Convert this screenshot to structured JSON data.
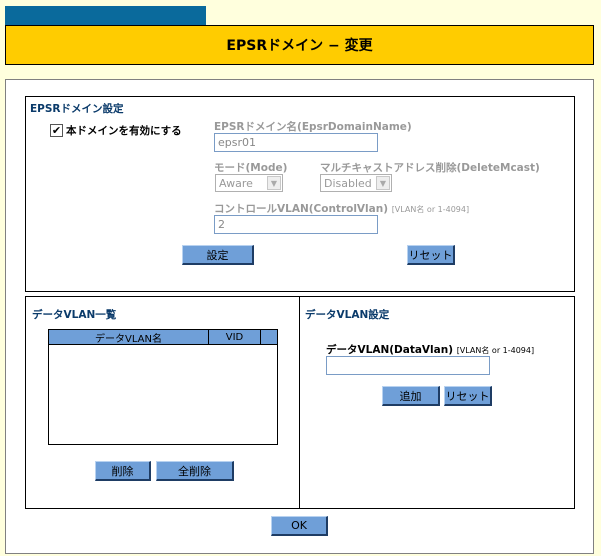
{
  "page": {
    "title": "EPSRドメイン − 変更"
  },
  "domain_settings": {
    "section_title": "EPSRドメイン設定",
    "enable_label": "本ドメインを有効にする",
    "enable_checked": true,
    "domain_name_label": "EPSRドメイン名(EpsrDomainName)",
    "domain_name_value": "epsr01",
    "mode_label": "モード(Mode)",
    "mode_value": "Aware",
    "mcast_label": "マルチキャストアドレス削除(DeleteMcast)",
    "mcast_value": "Disabled",
    "control_vlan_label": "コントロールVLAN(ControlVlan)",
    "control_vlan_hint": "[VLAN名 or 1-4094]",
    "control_vlan_value": "2",
    "set_button": "設定",
    "reset_button": "リセット"
  },
  "data_vlan_list": {
    "section_title": "データVLAN一覧",
    "columns": [
      "データVLAN名",
      "VID"
    ],
    "rows": [],
    "delete_button": "削除",
    "delete_all_button": "全削除"
  },
  "data_vlan_add": {
    "section_title": "データVLAN設定",
    "field_label": "データVLAN(DataVlan)",
    "field_hint": "[VLAN名 or 1-4094]",
    "field_value": "",
    "add_button": "追加",
    "reset_button": "リセット"
  },
  "footer": {
    "ok_button": "OK"
  },
  "colors": {
    "title_bar": "#ffcc00",
    "tab": "#0a6a9c",
    "button": "#6f9fd8",
    "background": "#ffffdd"
  }
}
